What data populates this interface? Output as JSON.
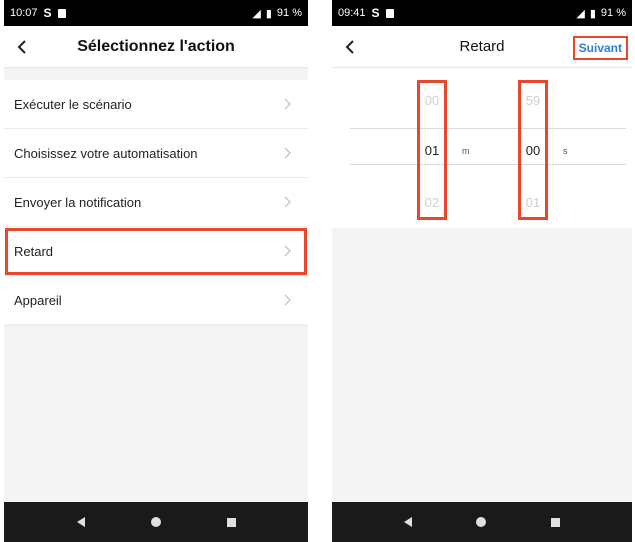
{
  "left": {
    "status": {
      "time": "10:07",
      "battery": "91 %"
    },
    "title": "Sélectionnez l'action",
    "items": [
      {
        "label": "Exécuter le scénario"
      },
      {
        "label": "Choisissez votre automatisation"
      },
      {
        "label": "Envoyer la notification"
      },
      {
        "label": "Retard"
      },
      {
        "label": "Appareil"
      }
    ]
  },
  "right": {
    "status": {
      "time": "09:41",
      "battery": "91 %"
    },
    "title": "Retard",
    "next_label": "Suivant",
    "minutes": {
      "above": "00",
      "selected": "01",
      "below": "02",
      "unit": "m"
    },
    "seconds": {
      "above": "59",
      "selected": "00",
      "below": "01",
      "unit": "s"
    }
  },
  "colors": {
    "highlight": "#e8472c",
    "link": "#2f7ed8",
    "navbar_bottom": "#1a1a1a"
  },
  "icons": [
    "back-chevron",
    "chevron-right",
    "nav-back-triangle",
    "nav-home-circle",
    "nav-recent-square"
  ]
}
